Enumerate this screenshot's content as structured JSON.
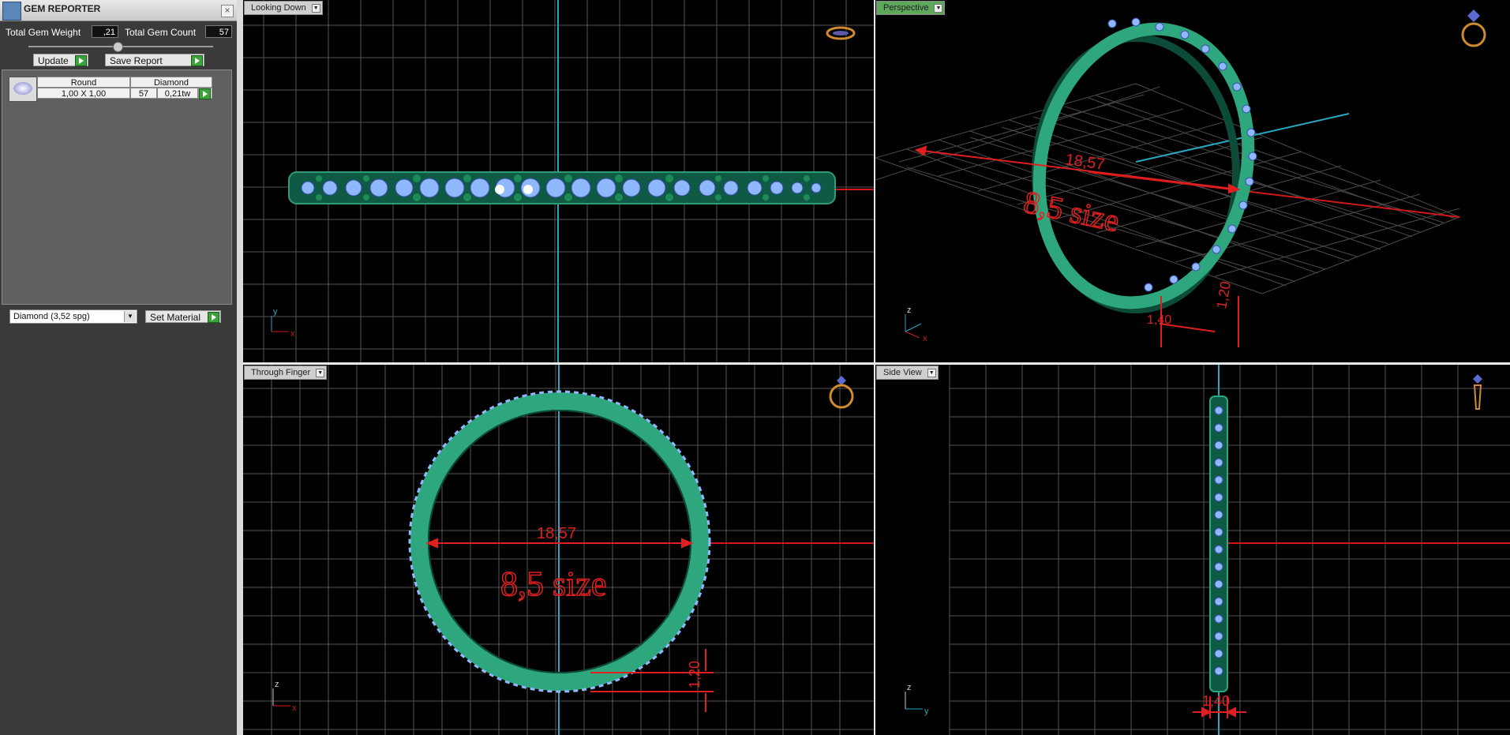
{
  "panel": {
    "title": "GEM REPORTER",
    "close": "×",
    "total_weight_label": "Total Gem Weight",
    "total_weight_value": ",21",
    "total_count_label": "Total Gem Count",
    "total_count_value": "57",
    "update_label": "Update",
    "save_label": "Save Report",
    "gem_table": {
      "headers": [
        "Round",
        "Diamond"
      ],
      "row": {
        "size": "1,00 X 1,00",
        "count": "57",
        "weight": "0,21tw"
      }
    },
    "material_value": "Diamond    (3,52 spg)",
    "set_material_label": "Set Material"
  },
  "viewports": {
    "top": {
      "label": "Looking Down",
      "axes": [
        "y",
        "x"
      ]
    },
    "perspective": {
      "label": "Perspective",
      "axes": [
        "z",
        "x"
      ],
      "dimension": "18,57",
      "size_text": "8,5 size",
      "dim_small1": "1,20",
      "dim_small2": "1,40"
    },
    "front": {
      "label": "Through Finger",
      "axes": [
        "z",
        "x"
      ],
      "dimension": "18,57",
      "size_text": "8,5 size",
      "dim_small": "1,20"
    },
    "side": {
      "label": "Side View",
      "axes": [
        "z",
        "y"
      ],
      "dimension": "1,40"
    }
  },
  "colors": {
    "band": "#3fb08a",
    "gem": "#8fb8ff",
    "dimension": "#e02020",
    "axis": "#2aa6c0",
    "grid": "#555555",
    "accent_icon": "#d08a30"
  }
}
